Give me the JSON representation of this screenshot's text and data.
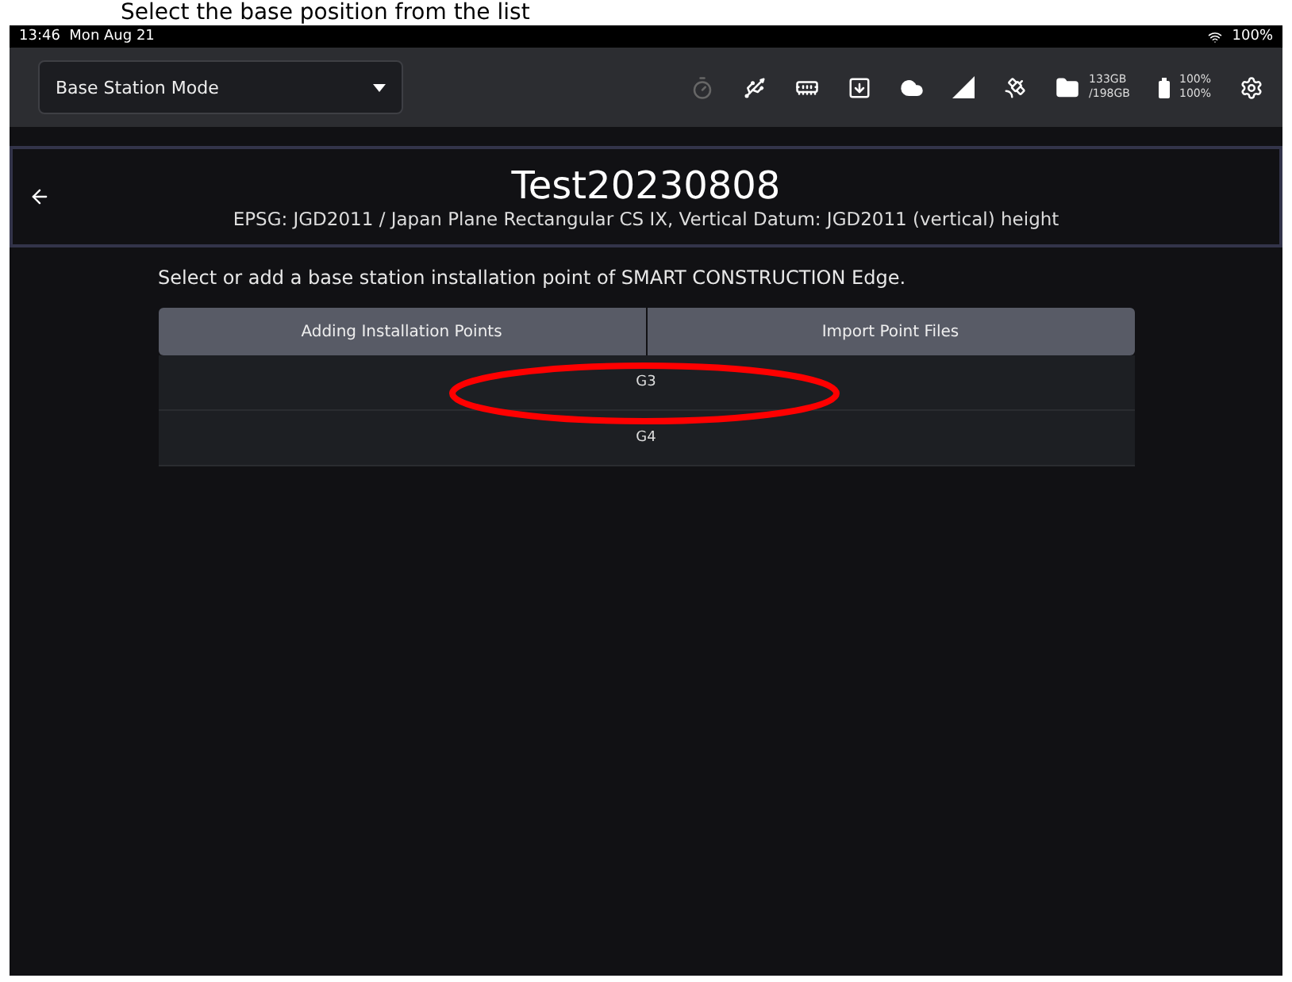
{
  "caption": "Select the base position from the list",
  "status_bar": {
    "time": "13:46",
    "date": "Mon Aug 21",
    "battery": "100%"
  },
  "toolbar": {
    "mode": "Base Station Mode",
    "storage": [
      "133GB",
      "/198GB"
    ],
    "battery": [
      "100%",
      "100%"
    ]
  },
  "header": {
    "title": "Test20230808",
    "subtitle": "EPSG: JGD2011 / Japan Plane Rectangular CS IX, Vertical Datum: JGD2011 (vertical) height"
  },
  "instruction": "Select or add a base station installation point of SMART CONSTRUCTION Edge.",
  "actions": [
    {
      "label": "Adding Installation Points"
    },
    {
      "label": "Import Point Files"
    }
  ],
  "points": [
    {
      "name": "G3"
    },
    {
      "name": "G4"
    }
  ]
}
